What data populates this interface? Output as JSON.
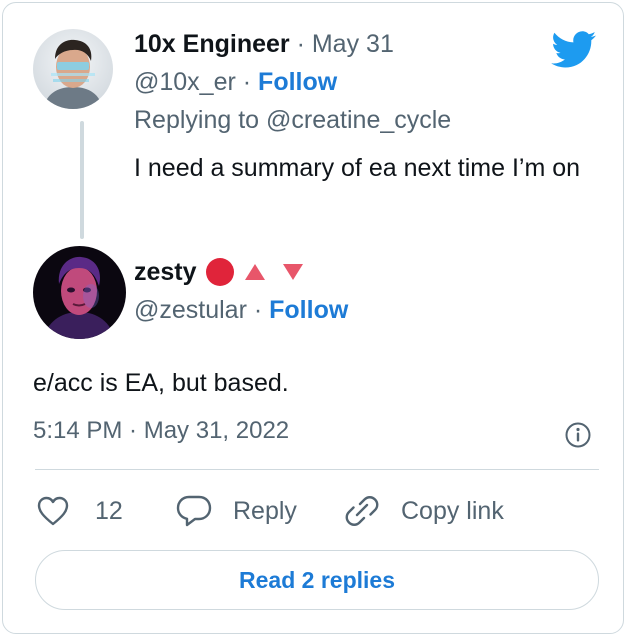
{
  "parent_tweet": {
    "display_name": "10x Engineer",
    "date": "May 31",
    "handle": "@10x_er",
    "follow_label": "Follow",
    "replying_to_prefix": "Replying to",
    "replying_to_handle": "@creatine_cycle",
    "text": "I need a summary of ea next time I’m on"
  },
  "main_tweet": {
    "display_name": "zesty",
    "handle": "@zestular",
    "follow_label": "Follow",
    "text": "e/acc is EA, but based.",
    "timestamp": "5:14 PM · May 31, 2022"
  },
  "actions": {
    "like_count": "12",
    "reply_label": "Reply",
    "copy_link_label": "Copy link"
  },
  "read_replies_label": "Read 2 replies",
  "colors": {
    "accent": "#1d7bd6",
    "twitter_blue": "#1d9bf0",
    "muted": "#536471",
    "border": "#cfd9de",
    "name_emoji_red": "#e0243a",
    "name_emoji_pink": "#e8566a"
  },
  "icons": [
    "twitter-bird-icon",
    "info-icon",
    "heart-icon",
    "reply-bubble-icon",
    "link-icon",
    "red-circle-emoji",
    "up-triangle-emoji",
    "down-triangle-emoji"
  ]
}
